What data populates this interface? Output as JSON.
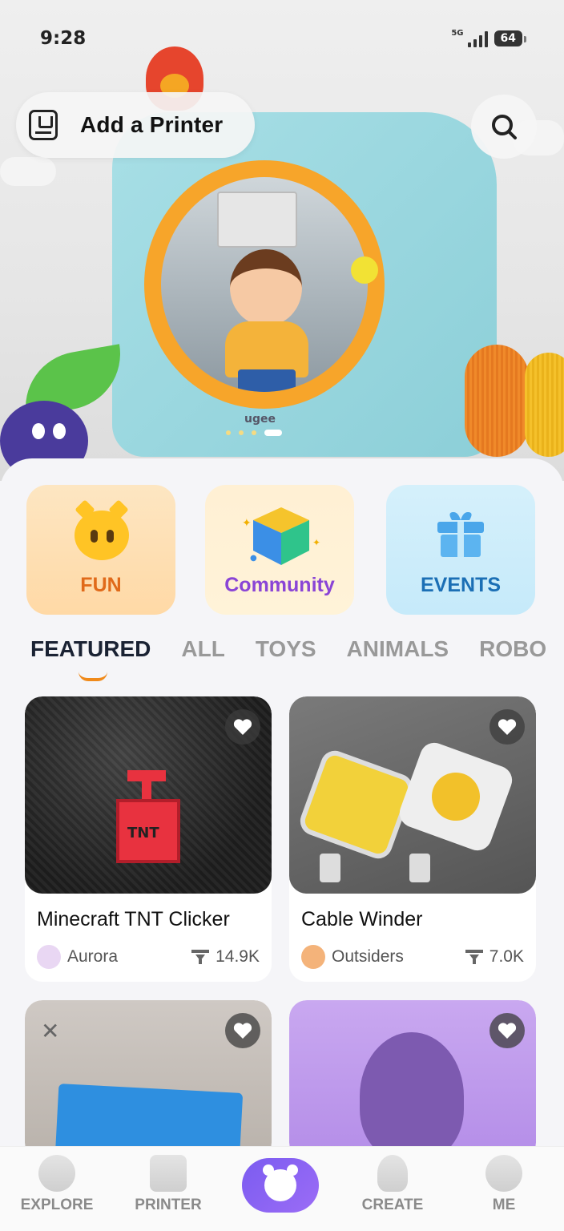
{
  "status_bar": {
    "time": "9:28",
    "network": "5G",
    "battery": "64"
  },
  "hero": {
    "add_printer_label": "Add a Printer",
    "brand": "ugee",
    "carousel": {
      "count": 4,
      "active": 3
    }
  },
  "categories": [
    {
      "label": "FUN"
    },
    {
      "label": "Community"
    },
    {
      "label": "EVENTS"
    }
  ],
  "tabs": [
    "FEATURED",
    "ALL",
    "TOYS",
    "ANIMALS",
    "ROBO"
  ],
  "active_tab": "FEATURED",
  "cards": [
    {
      "title": "Minecraft TNT Clicker",
      "author": "Aurora",
      "downloads": "14.9K"
    },
    {
      "title": "Cable Winder",
      "author": "Outsiders",
      "downloads": "7.0K"
    },
    {
      "title": "",
      "author": "",
      "downloads": ""
    },
    {
      "title": "",
      "author": "",
      "downloads": ""
    }
  ],
  "bottom_nav": {
    "explore": "EXPLORE",
    "printer": "PRINTER",
    "create": "CREATE",
    "me": "ME"
  },
  "colors": {
    "fun": "#e06a1a",
    "community": "#8a44d6",
    "events": "#1b6fb5",
    "tab_indicator": "#f08a1a",
    "center_nav": "#7b5cf0"
  },
  "icons": {
    "add_printer": "printer-icon",
    "search": "search-icon",
    "fun": "smiley-cat-icon",
    "community": "cube-icon",
    "events": "gift-icon",
    "heart": "heart-icon",
    "download": "download-icon"
  }
}
